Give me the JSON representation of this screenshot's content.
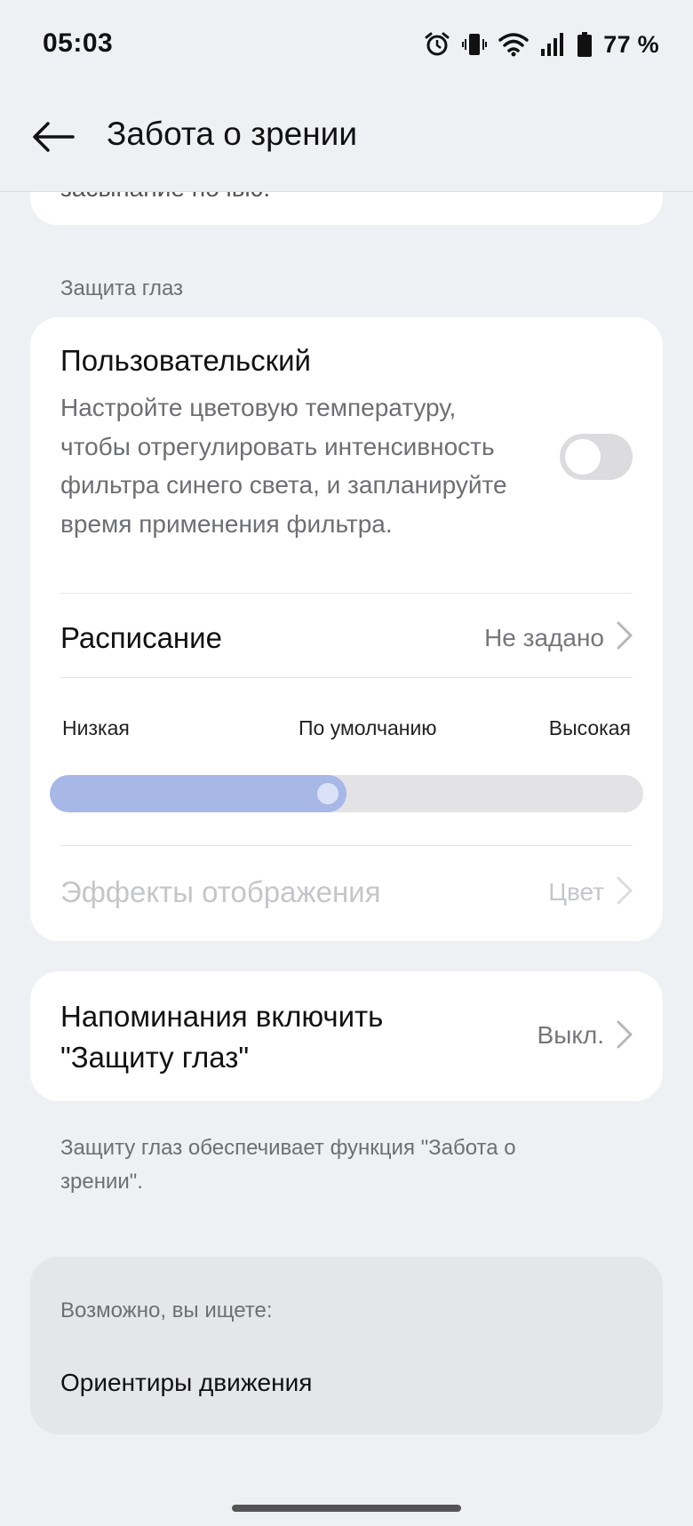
{
  "status_bar": {
    "time": "05:03",
    "battery": "77 %"
  },
  "header": {
    "title": "Забота о зрении"
  },
  "partial_card": {
    "text": "засыпание ночью."
  },
  "eye_protection": {
    "section_label": "Защита глаз",
    "custom_title": "Пользовательский",
    "custom_description": "Настройте цветовую температуру, чтобы отрегулировать интенсивность фильтра синего света, и запланируйте время применения фильтра.",
    "custom_enabled": false,
    "schedule_label": "Расписание",
    "schedule_value": "Не задано",
    "intensity_low": "Низкая",
    "intensity_default": "По умолчанию",
    "intensity_high": "Высокая",
    "intensity_level": 0.5,
    "display_effects_label": "Эффекты отображения",
    "display_effects_value": "Цвет"
  },
  "reminder": {
    "label": "Напоминания включить \"Защиту глаз\"",
    "value": "Выкл."
  },
  "footnote": "Защиту глаз обеспечивает функция \"Забота о зрении\".",
  "suggestions": {
    "label": "Возможно, вы ищете:",
    "item": "Ориентиры движения"
  },
  "colors": {
    "background": "#eff0f3",
    "slider_fill": "#a7b7e6",
    "toggle_off": "#dcdcde"
  }
}
